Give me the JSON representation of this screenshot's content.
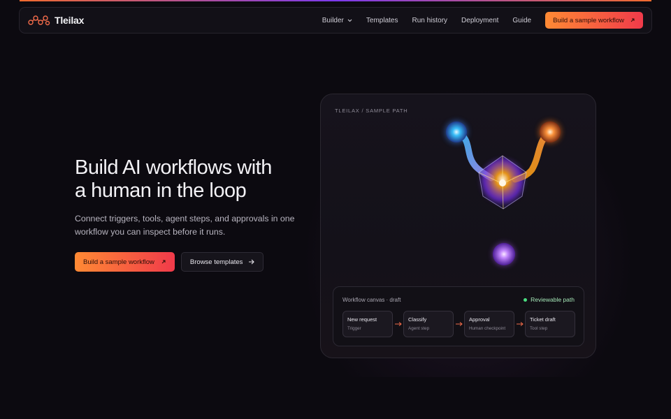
{
  "brand": {
    "name": "Tleilax",
    "accent_start": "#ff8a34",
    "accent_end": "#f03a4a"
  },
  "nav": {
    "items": [
      {
        "label": "Builder",
        "has_dropdown": true
      },
      {
        "label": "Templates"
      },
      {
        "label": "Run history"
      },
      {
        "label": "Deployment"
      },
      {
        "label": "Guide"
      }
    ],
    "cta_label": "Build a sample workflow"
  },
  "hero": {
    "title_line1": "Build AI workflows with",
    "title_line2": "a human in the loop",
    "subtitle_line1": "Connect triggers, tools, agent steps, and approvals in one",
    "subtitle_line2": "workflow you can inspect before it runs.",
    "primary_label": "Build a sample workflow",
    "secondary_label": "Browse templates"
  },
  "card": {
    "eyebrow": "TLEILAX / SAMPLE PATH",
    "canvas_title": "Workflow canvas · draft",
    "status_label": "Reviewable path",
    "status_color": "#4ade80",
    "steps": [
      {
        "title": "New request",
        "subtitle": "Trigger"
      },
      {
        "title": "Classify",
        "subtitle": "Agent step"
      },
      {
        "title": "Approval",
        "subtitle": "Human checkpoint"
      },
      {
        "title": "Ticket draft",
        "subtitle": "Tool step"
      }
    ]
  }
}
